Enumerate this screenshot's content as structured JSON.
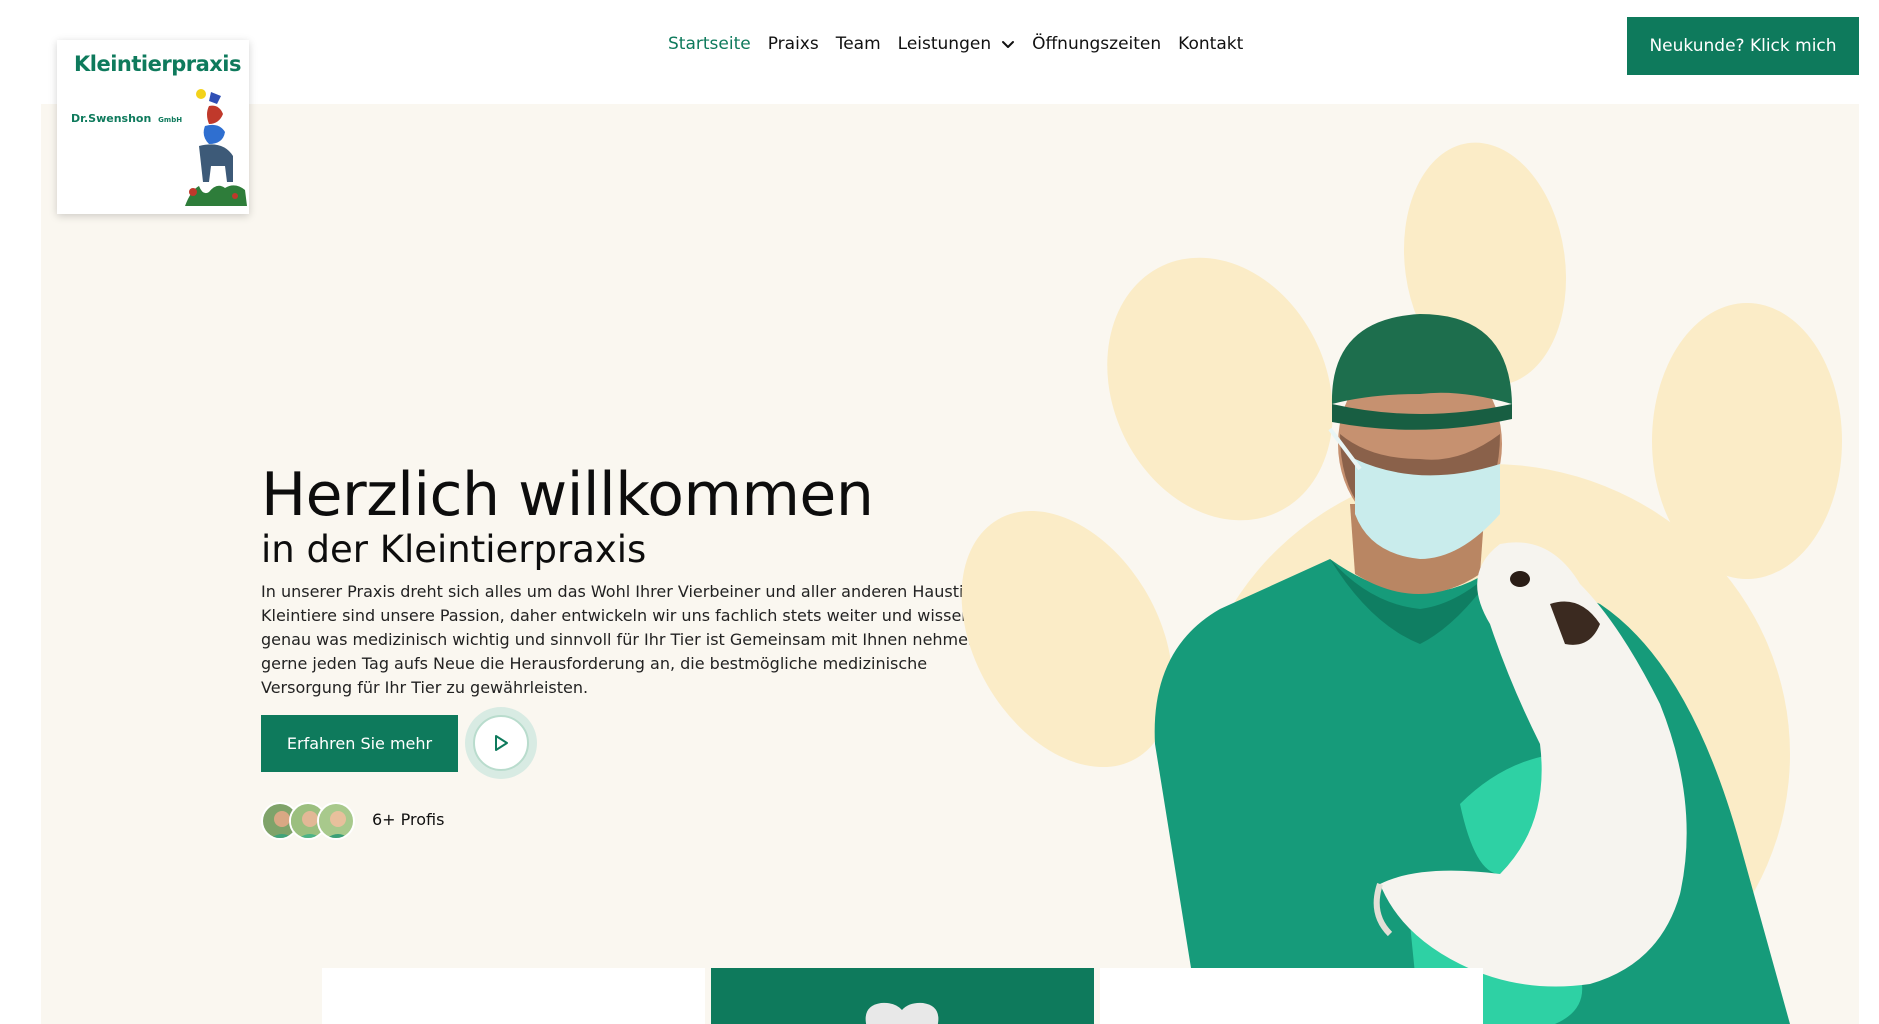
{
  "brand": {
    "title": "Kleintierpraxis",
    "subtitle": "Dr.Swenshon",
    "subtitle_small": "GmbH"
  },
  "nav": {
    "items": [
      {
        "label": "Startseite",
        "active": true
      },
      {
        "label": "Praixs",
        "active": false
      },
      {
        "label": "Team",
        "active": false
      },
      {
        "label": "Leistungen",
        "active": false,
        "dropdown": true
      },
      {
        "label": "Öffnungszeiten",
        "active": false
      },
      {
        "label": "Kontakt",
        "active": false
      }
    ],
    "cta_label": "Neukunde? Klick mich"
  },
  "hero": {
    "headline": "Herzlich willkommen",
    "subheadline": "in der Kleintierpraxis",
    "intro": "In unserer Praxis dreht sich alles um das Wohl Ihrer Vierbeiner und aller anderen Haustiere. Kleintiere sind unsere Passion, daher entwickeln wir uns fachlich stets weiter und wissen somit genau was medizinisch wichtig und sinnvoll für Ihr Tier ist Gemeinsam mit Ihnen nehmen wir gerne jeden Tag aufs Neue die Herausforderung an, die bestmögliche medizinische Versorgung für Ihr Tier zu gewährleisten.",
    "button_label": "Erfahren Sie mehr",
    "play_icon": "play-icon",
    "team_count_label": "6+ Profis"
  },
  "colors": {
    "accent": "#0e7a5c",
    "hero_bg": "#faf7f0",
    "paw": "#fbecc7"
  },
  "cards": [
    {
      "variant": "white"
    },
    {
      "variant": "green"
    },
    {
      "variant": "white"
    }
  ]
}
